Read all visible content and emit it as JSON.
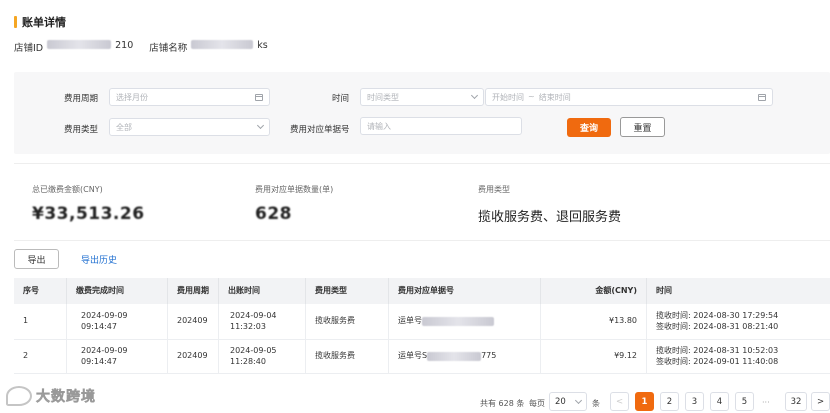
{
  "page": {
    "title": "账单详情"
  },
  "store": {
    "id_label": "店铺ID",
    "id_value_suffix": "210",
    "name_label": "店铺名称",
    "name_value_suffix": "ks"
  },
  "filters": {
    "period_label": "费用周期",
    "period_placeholder": "选择月份",
    "time_label": "时间",
    "time_type_placeholder": "时间类型",
    "start_placeholder": "开始时间",
    "range_sep": "~",
    "end_placeholder": "结束时间",
    "type_label": "费用类型",
    "type_value": "全部",
    "docno_label": "费用对应单据号",
    "docno_placeholder": "请输入",
    "search_label": "查询",
    "reset_label": "重置"
  },
  "summary": {
    "total_label": "总已缴费金额(CNY)",
    "total_value": "¥33,513.26",
    "count_label": "费用对应单据数量(单)",
    "count_value": "628",
    "types_label": "费用类型",
    "types_value": "揽收服务费、退回服务费"
  },
  "actions": {
    "export_label": "导出",
    "history_label": "导出历史"
  },
  "table": {
    "headers": [
      "序号",
      "缴费完成时间",
      "费用周期",
      "出账时间",
      "费用类型",
      "费用对应单据号",
      "金额(CNY)",
      "时间"
    ],
    "rows": [
      {
        "seq": "1",
        "paid_date": "2024-09-09",
        "paid_time": "09:14:47",
        "period": "202409",
        "bill_date": "2024-09-04",
        "bill_time": "11:32:03",
        "type": "揽收服务费",
        "doc_prefix": "运单号",
        "doc_suffix": "",
        "amount": "¥13.80",
        "time1": "揽收时间: 2024-08-30 17:29:54",
        "time2": "签收时间: 2024-08-31 08:21:40"
      },
      {
        "seq": "2",
        "paid_date": "2024-09-09",
        "paid_time": "09:14:47",
        "period": "202409",
        "bill_date": "2024-09-05",
        "bill_time": "11:28:40",
        "type": "揽收服务费",
        "doc_prefix": "运单号S",
        "doc_suffix": "775",
        "amount": "¥9.12",
        "time1": "揽收时间: 2024-08-31 10:52:03",
        "time2": "签收时间: 2024-09-01 11:40:08"
      }
    ]
  },
  "pagination": {
    "total_text": "共有 628 条",
    "per_page_label": "每页",
    "page_size": "20",
    "unit": "条",
    "pages": [
      "1",
      "2",
      "3",
      "4",
      "5"
    ],
    "ellipsis": "···",
    "last_page": "32",
    "current": "1"
  },
  "watermark": {
    "brand": "大数跨境"
  }
}
